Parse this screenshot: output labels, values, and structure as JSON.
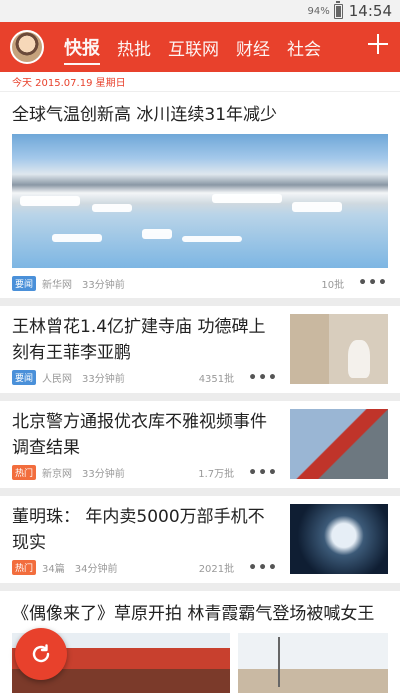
{
  "status": {
    "battery": "94%",
    "time": "14:54"
  },
  "nav": {
    "tabs": [
      "快报",
      "热批",
      "互联网",
      "财经",
      "社会"
    ]
  },
  "date": "今天 2015.07.19 星期日",
  "feature": {
    "title": "全球气温创新高 冰川连续31年减少",
    "tag": "要闻",
    "source": "新华网",
    "time": "33分钟前",
    "count": "10批"
  },
  "items": [
    {
      "title": "王林曾花1.4亿扩建寺庙 功德碑上刻有王菲李亚鹏",
      "tag": "要闻",
      "source": "人民网",
      "time": "33分钟前",
      "count": "4351批"
    },
    {
      "title": "北京警方通报优衣库不雅视频事件调查结果",
      "tag": "热门",
      "source": "新京网",
      "time": "33分钟前",
      "count": "1.7万批"
    },
    {
      "title": "董明珠： 年内卖5000万部手机不现实",
      "tag": "热门",
      "source": "34篇",
      "time": "34分钟前",
      "count": "2021批"
    }
  ],
  "last": {
    "title": "《偶像来了》草原开拍 林青霞霸气登场被喊女王"
  },
  "colors": {
    "accent": "#e8412c",
    "tag_blue": "#4a90d9",
    "tag_orange": "#f26d3d"
  },
  "icons": {
    "more": "more-dots-icon",
    "plus": "plus-icon",
    "refresh": "refresh-icon"
  }
}
